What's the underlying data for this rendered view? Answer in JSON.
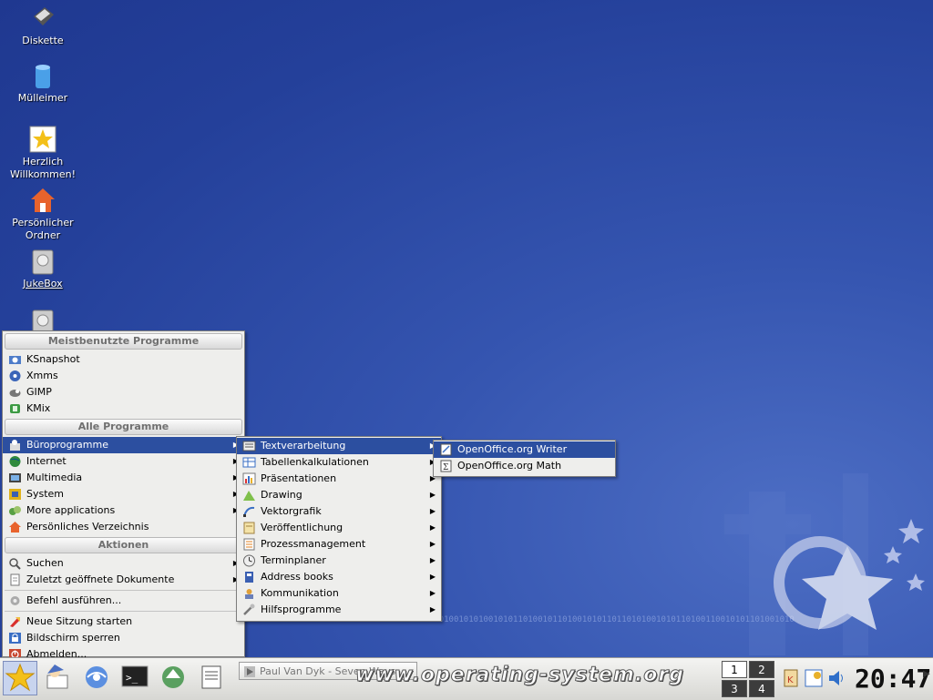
{
  "desktop": {
    "icons": [
      {
        "label": "Diskette",
        "icon": "floppy-icon"
      },
      {
        "label": "Mülleimer",
        "icon": "trash-icon"
      },
      {
        "label": "Herzlich Willkommen!",
        "icon": "welcome-star-icon"
      },
      {
        "label": "Persönlicher Ordner",
        "icon": "home-folder-icon"
      },
      {
        "label": "JukeBox",
        "icon": "harddisk-icon"
      },
      {
        "label": "",
        "icon": "harddisk-icon"
      }
    ]
  },
  "kmenu": {
    "section_most_used": "Meistbenutzte Programme",
    "most_used": [
      {
        "label": "KSnapshot",
        "icon": "camera-icon"
      },
      {
        "label": "Xmms",
        "icon": "xmms-icon"
      },
      {
        "label": "GIMP",
        "icon": "gimp-icon"
      },
      {
        "label": "KMix",
        "icon": "mixer-icon"
      }
    ],
    "section_all": "Alle Programme",
    "all_programs": [
      {
        "label": "Büroprogramme",
        "icon": "office-icon",
        "submenu": true,
        "selected": true
      },
      {
        "label": "Internet",
        "icon": "globe-icon",
        "submenu": true
      },
      {
        "label": "Multimedia",
        "icon": "multimedia-icon",
        "submenu": true
      },
      {
        "label": "System",
        "icon": "system-icon",
        "submenu": true
      },
      {
        "label": "More applications",
        "icon": "more-apps-icon",
        "submenu": true
      },
      {
        "label": "Persönliches Verzeichnis",
        "icon": "home-icon",
        "submenu": false
      }
    ],
    "section_actions": "Aktionen",
    "actions": [
      {
        "label": "Suchen",
        "icon": "search-icon",
        "submenu": true
      },
      {
        "label": "Zuletzt geöffnete Dokumente",
        "icon": "recent-docs-icon",
        "submenu": true
      },
      {
        "label": "Befehl ausführen...",
        "icon": "run-command-icon",
        "submenu": false
      },
      {
        "label": "Neue Sitzung starten",
        "icon": "new-session-icon",
        "submenu": false
      },
      {
        "label": "Bildschirm sperren",
        "icon": "lock-icon",
        "submenu": false
      },
      {
        "label": "Abmelden...",
        "icon": "logout-icon",
        "submenu": false
      }
    ]
  },
  "office_menu": {
    "items": [
      {
        "label": "Textverarbeitung",
        "icon": "word-processor-icon",
        "selected": true
      },
      {
        "label": "Tabellenkalkulationen",
        "icon": "spreadsheet-icon"
      },
      {
        "label": "Präsentationen",
        "icon": "presentation-icon"
      },
      {
        "label": "Drawing",
        "icon": "drawing-icon"
      },
      {
        "label": "Vektorgrafik",
        "icon": "vector-icon"
      },
      {
        "label": "Veröffentlichung",
        "icon": "publishing-icon"
      },
      {
        "label": "Prozessmanagement",
        "icon": "process-icon"
      },
      {
        "label": "Terminplaner",
        "icon": "calendar-icon"
      },
      {
        "label": "Address books",
        "icon": "addressbook-icon"
      },
      {
        "label": "Kommunikation",
        "icon": "communication-icon"
      },
      {
        "label": "Hilfsprogramme",
        "icon": "utilities-icon"
      }
    ]
  },
  "text_menu": {
    "items": [
      {
        "label": "OpenOffice.org Writer",
        "icon": "writer-icon",
        "selected": true
      },
      {
        "label": "OpenOffice.org Math",
        "icon": "math-icon"
      }
    ]
  },
  "taskbar": {
    "quicklaunch": [
      "k-menu-star-icon",
      "kde-help-icon",
      "konqueror-icon",
      "terminal-icon",
      "kget-icon",
      "writer-icon"
    ],
    "task_label": "Paul Van Dyk - Seven Ways",
    "watermark": "www.operating-system.org",
    "pager": [
      "1",
      "2",
      "3",
      "4"
    ],
    "active_desktop": "1",
    "clock": "20:47"
  },
  "colors": {
    "desktop_blue": "#2b47a2",
    "menu_bg": "#eeeeec",
    "selection": "#2c4fa0"
  }
}
